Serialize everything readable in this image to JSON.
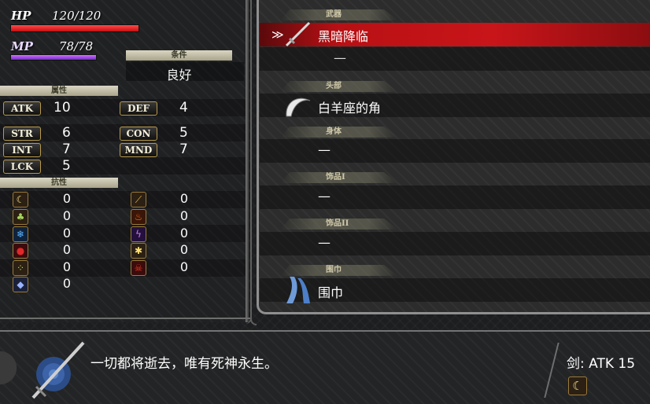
{
  "status": {
    "hp_label": "HP",
    "hp_value": "120/120",
    "hp_fraction": 1.0,
    "mp_label": "MP",
    "mp_value": "78/78",
    "mp_fraction": 1.0,
    "condition_header": "条件",
    "condition_value": "良好",
    "attributes_header": "属性",
    "resistance_header": "抗性"
  },
  "stats": {
    "atk": {
      "label": "ATK",
      "value": "10"
    },
    "def": {
      "label": "DEF",
      "value": "4"
    },
    "str": {
      "label": "STR",
      "value": "6"
    },
    "con": {
      "label": "CON",
      "value": "5"
    },
    "int": {
      "label": "INT",
      "value": "7"
    },
    "mnd": {
      "label": "MND",
      "value": "7"
    },
    "lck": {
      "label": "LCK",
      "value": "5"
    }
  },
  "resistances": {
    "left": [
      {
        "icon": "moon-icon",
        "value": "0"
      },
      {
        "icon": "earth-icon",
        "value": "0"
      },
      {
        "icon": "water-icon",
        "value": "0"
      },
      {
        "icon": "blood-icon",
        "value": "0"
      },
      {
        "icon": "poison-icon",
        "value": "0"
      },
      {
        "icon": "crystal-icon",
        "value": "0"
      }
    ],
    "right": [
      {
        "icon": "wind-icon",
        "value": "0"
      },
      {
        "icon": "fire-icon",
        "value": "0"
      },
      {
        "icon": "lightning-icon",
        "value": "0"
      },
      {
        "icon": "holy-icon",
        "value": "0"
      },
      {
        "icon": "skull-icon",
        "value": "0"
      }
    ]
  },
  "equipment": {
    "weapon_header": "武器",
    "weapon_item": "黑暗降临",
    "weapon_sub": "—",
    "head_header": "头部",
    "head_item": "白羊座的角",
    "body_header": "身体",
    "body_item": "—",
    "acc1_header": "饰品I",
    "acc1_item": "—",
    "acc2_header": "饰品II",
    "acc2_item": "—",
    "scarf_header": "围巾",
    "scarf_item": "围巾"
  },
  "description": {
    "text": "一切都将逝去，唯有死神永生。",
    "stat": "剑: ATK 15"
  },
  "colors": {
    "selected_row": "#c8151a",
    "hp_bar": "#e02020",
    "mp_bar": "#9040e0",
    "badge_border": "#b79a4a"
  }
}
